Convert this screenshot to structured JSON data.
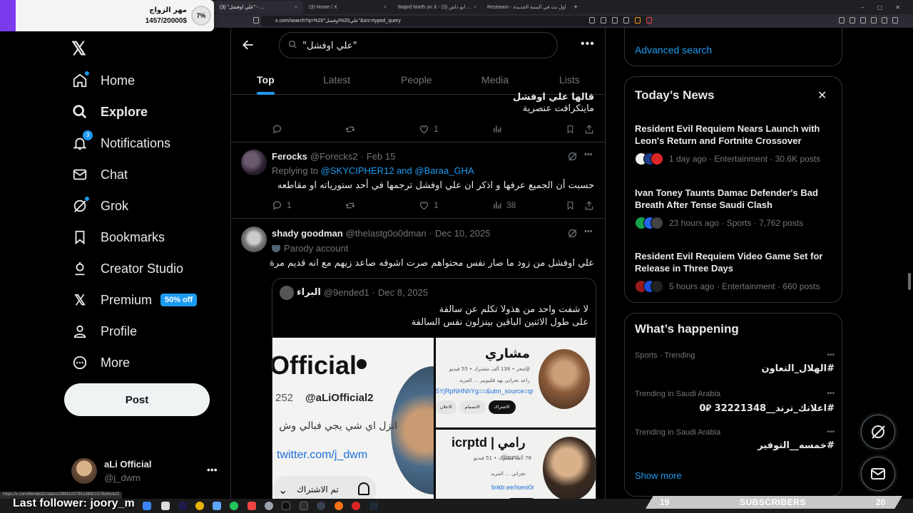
{
  "browser": {
    "tabs": [
      {
        "title": "(3) \"علي اوفشل\" - ..."
      },
      {
        "title": "(3) Home / X"
      },
      {
        "title": "Majed North on X - (3) ابو داش ..."
      },
      {
        "title": "Restream - اول بث في السنة الجديدة"
      }
    ],
    "url": "x.com/search?q=%20\"علي20%اوفشل\"&src=typed_query",
    "status_url": "https://x.com/9ended1/status/1998103795188801578/photo/2"
  },
  "donation": {
    "title": "مهر الزواج",
    "amount": "1457/20000$",
    "percent": "7%"
  },
  "nav": {
    "items": [
      {
        "label": "Home",
        "icon": "home-icon"
      },
      {
        "label": "Explore",
        "icon": "search-icon"
      },
      {
        "label": "Notifications",
        "icon": "bell-icon",
        "badge": "3"
      },
      {
        "label": "Chat",
        "icon": "mail-icon"
      },
      {
        "label": "Grok",
        "icon": "grok-icon"
      },
      {
        "label": "Bookmarks",
        "icon": "bookmark-icon"
      },
      {
        "label": "Creator Studio",
        "icon": "creator-icon"
      },
      {
        "label": "Premium",
        "icon": "x-icon",
        "promo": "50% off"
      },
      {
        "label": "Profile",
        "icon": "person-icon"
      },
      {
        "label": "More",
        "icon": "more-circle-icon"
      }
    ],
    "post_label": "Post",
    "account": {
      "name": "aLi Official",
      "handle": "@j_dwm"
    }
  },
  "search": {
    "query": "\"علي اوفشل\""
  },
  "search_tabs": [
    "Top",
    "Latest",
    "People",
    "Media",
    "Lists"
  ],
  "partial_tweet": {
    "line1": "قالها علي اوفشل",
    "line2": "ماينكرافت عنصرية",
    "likes": "1"
  },
  "tweet1": {
    "name": "Ferocks",
    "handle": "@Forecks2",
    "date": "Feb 15",
    "replying_to": "Replying to",
    "reply_targets": "@SKYCIPHER12 and @Baraa_GHA",
    "text": "حسبت أن الجميع عرفها و اذكر ان علي اوفشل ترجمها في أحد ستورياته او مقاطعه",
    "replies": "1",
    "likes": "1",
    "views": "38"
  },
  "tweet2": {
    "name": "shady goodman",
    "handle": "@thelastg0o0dman",
    "date": "Dec 10, 2025",
    "label": "Parody account",
    "text": "علي اوفشل من زود ما صار نفس محتواهم صرت اشوفه صاعد زيهم مع انه قديم مرة",
    "quote": {
      "name": "البراء",
      "handle": "@9ended1",
      "date": "Dec 8, 2025",
      "line1": "لا شفت واحد من هذولا تكلم عن سالفة",
      "line2": "على طول الاثنين الباقين بينزلون نفس السالفة",
      "img1": {
        "big": "Official",
        "handle": "@aLiOfficial2",
        "num": "252",
        "bio": "انزل اي شي يجي فبالي وش",
        "link": "twitter.com/j_dwm",
        "sub": "تم الاشتراك"
      },
      "img2": {
        "name": "مشاري",
        "stats": "138 ألف مشترك • 55 فيديو",
        "handle": "@محر",
        "line": "راعد نجراني يهد فلتيوبير ... المزيد",
        "link": "5YjRpNHNhYg==&utm_source=qr",
        "b1": "الاشتراك",
        "b2": "الانضمام",
        "b3": "الاعلان"
      },
      "img3": {
        "name": "رامي | icrptd",
        "handle": "@icrptd",
        "stats": "78 ألف مشترك • 51 فيديو",
        "line": "نجراني ... المزيد",
        "link": "linktr.ee/iseni0r"
      }
    }
  },
  "right": {
    "advanced_search": "Advanced search",
    "news_title": "Today’s News",
    "news": [
      {
        "title": "Resident Evil Requiem Nears Launch with Leon's Return and Fortnite Crossover",
        "meta": "1 day ago · Entertainment · 30.6K posts"
      },
      {
        "title": "Ivan Toney Taunts Damac Defender's Bad Breath After Tense Saudi Clash",
        "meta": "23 hours ago · Sports · 7,762 posts"
      },
      {
        "title": "Resident Evil Requiem Video Game Set for Release in Three Days",
        "meta": "5 hours ago · Entertainment · 660 posts"
      }
    ],
    "happening_title": "What’s happening",
    "trends": [
      {
        "category": "Sports · Trending",
        "tag": "#الهلال_التعاون"
      },
      {
        "category": "Trending in Saudi Arabia",
        "tag": "#اعلانك_ترند__32221348 ⃁0"
      },
      {
        "category": "Trending in Saudi Arabia",
        "tag": "#خمسه__التوفير"
      }
    ],
    "show_more": "Show more"
  },
  "overlay": {
    "last_follower": "Last follower: joory_m",
    "subs_left": "19",
    "subs_label": "SUBSCRIBERS",
    "subs_right": "20"
  },
  "colors": {
    "accent": "#1d9bf0",
    "bg": "#000000",
    "text": "#e7e9ea",
    "muted": "#71767b",
    "border": "#2f3336"
  }
}
